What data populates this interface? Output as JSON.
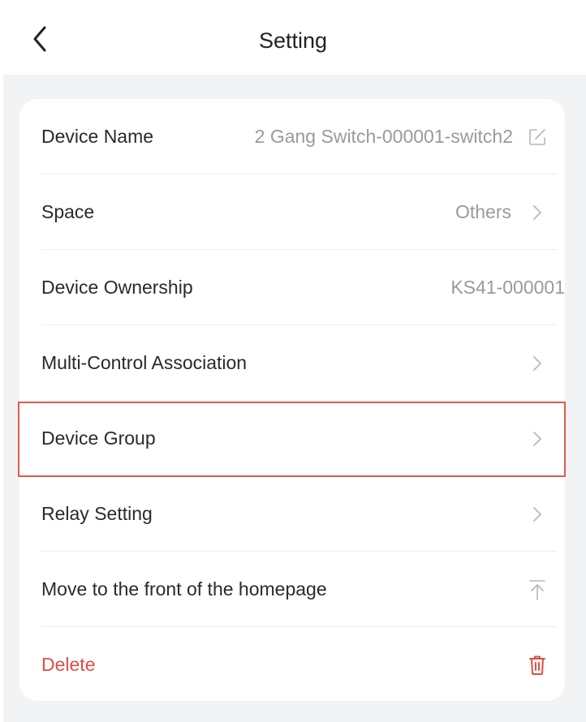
{
  "header": {
    "title": "Setting",
    "back_icon": "chevron-left-icon"
  },
  "settings": {
    "device_name": {
      "label": "Device Name",
      "value": "2 Gang Switch-000001-switch2",
      "icon": "edit-icon"
    },
    "space": {
      "label": "Space",
      "value": "Others",
      "icon": "chevron-right-icon"
    },
    "ownership": {
      "label": "Device Ownership",
      "value": "KS41-000001"
    },
    "multi_control": {
      "label": "Multi-Control Association",
      "icon": "chevron-right-icon"
    },
    "device_group": {
      "label": "Device Group",
      "icon": "chevron-right-icon",
      "highlighted": true
    },
    "relay": {
      "label": "Relay Setting",
      "icon": "chevron-right-icon"
    },
    "move_front": {
      "label": "Move to the front of the homepage",
      "icon": "move-to-top-icon"
    },
    "delete": {
      "label": "Delete",
      "icon": "trash-icon"
    }
  },
  "colors": {
    "accent_red": "#e04f43",
    "highlight_border": "#e25a4a",
    "background_gray": "#f2f3f5",
    "secondary_text": "#9a9a9a"
  }
}
